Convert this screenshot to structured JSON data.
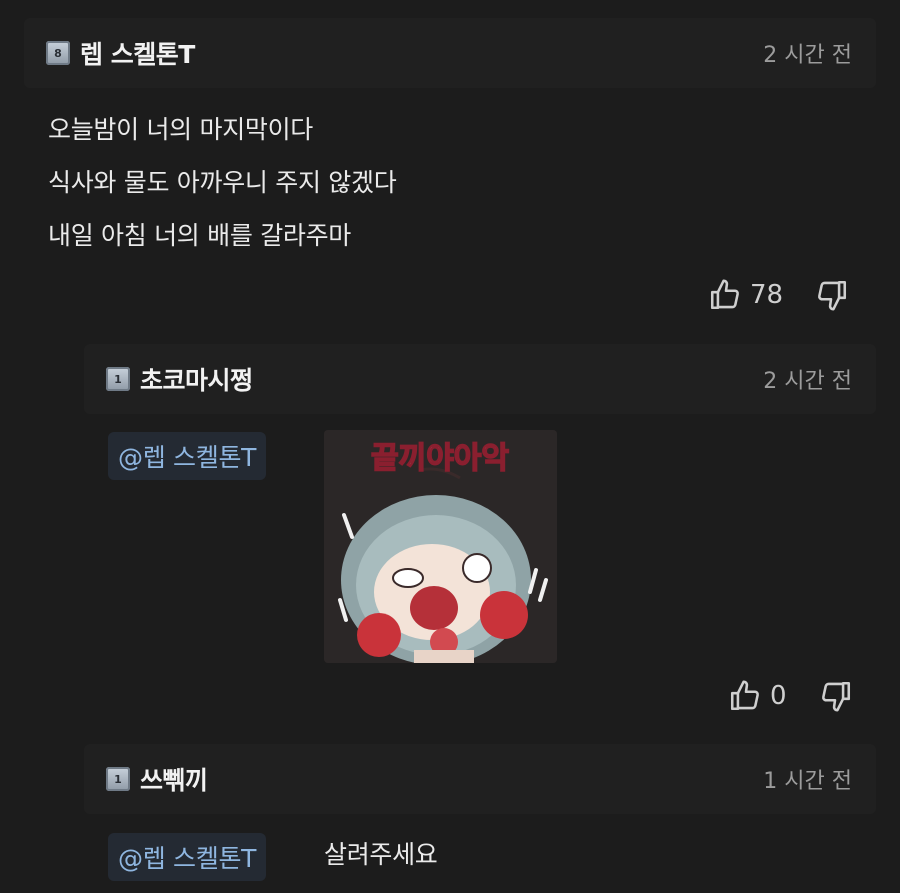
{
  "comments": [
    {
      "badge": "8",
      "username": "렙 스켈톤T",
      "time": "2 시간 전",
      "lines": [
        "오늘밤이 너의 마지막이다",
        "식사와 물도 아까우니 주지 않겠다",
        "내일 아침 너의 배를 갈라주마"
      ],
      "likes": "78"
    }
  ],
  "replies": [
    {
      "badge": "1",
      "username": "초코마시쩡",
      "time": "2 시간 전",
      "mention": "@렙 스켈톤T",
      "sticker_text": "끝끼야아악",
      "likes": "0"
    },
    {
      "badge": "1",
      "username": "쓰뻮끼",
      "time": "1 시간 전",
      "mention": "@렙 스켈톤T",
      "text": "살려주세요"
    }
  ],
  "colors": {
    "background": "#1c1c1c",
    "header": "#202020",
    "mention": "#8fb6e0",
    "mention_bg": "#242a33"
  }
}
